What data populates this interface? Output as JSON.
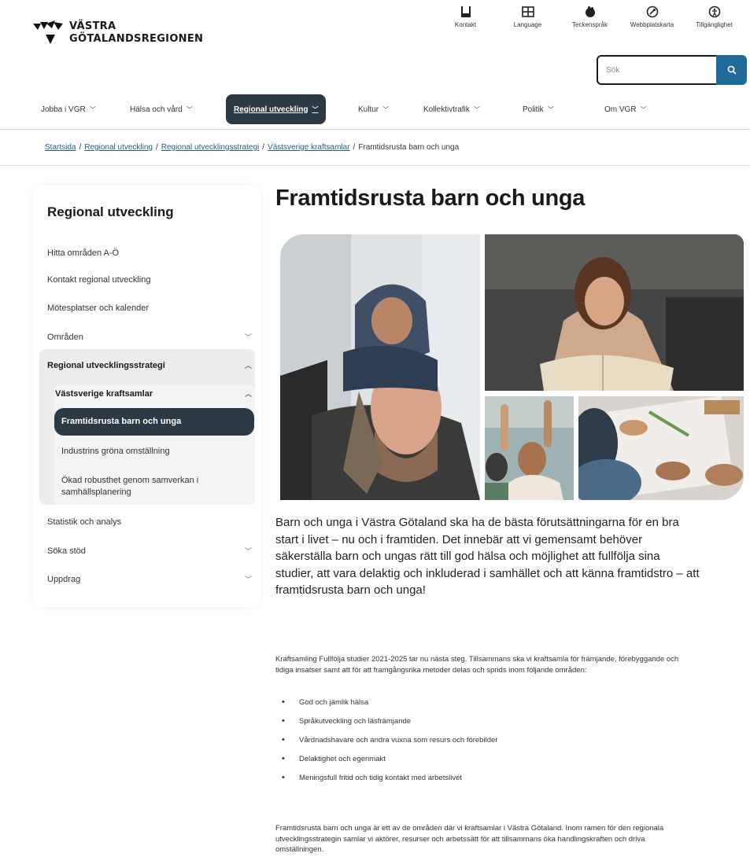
{
  "header": {
    "logo": {
      "line1": "VÄSTRA",
      "line2": "GÖTALANDSREGIONEN"
    },
    "util_nav": [
      {
        "label": "Kontakt",
        "icon": "phone-icon",
        "glyph": "☐"
      },
      {
        "label": "Language",
        "icon": "language-icon",
        "glyph": "⊞"
      },
      {
        "label": "Teckenspråk",
        "icon": "sign-language-icon",
        "glyph": "✋"
      },
      {
        "label": "Webbplatskarta",
        "icon": "sitemap-icon",
        "glyph": "⊘"
      },
      {
        "label": "Tillgänglighet",
        "icon": "accessibility-icon",
        "glyph": "☉"
      }
    ],
    "search": {
      "placeholder": "Sök"
    }
  },
  "main_nav": [
    {
      "label": "Jobba i VGR"
    },
    {
      "label": "Hälsa och vård"
    },
    {
      "label": "Regional utveckling"
    },
    {
      "label": "Kultur"
    },
    {
      "label": "Kollektivtrafik"
    },
    {
      "label": "Politik"
    },
    {
      "label": "Om VGR"
    }
  ],
  "breadcrumb": {
    "links": [
      "Startsida",
      "Regional utveckling",
      "Regional utvecklingsstrategi",
      "Västsverige kraftsamlar"
    ],
    "current": "Framtidsrusta barn och unga"
  },
  "sidebar": {
    "title": "Regional utveckling",
    "items": [
      {
        "label": "Hitta områden A-Ö"
      },
      {
        "label": "Kontakt regional utveckling"
      },
      {
        "label": "Mötesplatser och kalender"
      },
      {
        "label": "Områden"
      },
      {
        "label": "Regional utvecklingsstrategi"
      },
      {
        "label": "Västsverige kraftsamlar"
      },
      {
        "label": "Framtidsrusta barn och unga"
      },
      {
        "label": "Industrins gröna omställning"
      },
      {
        "label": "Ökad robusthet genom samverkan i samhällsplanering"
      },
      {
        "label": "Statistik och analys"
      },
      {
        "label": "Söka stöd"
      },
      {
        "label": "Uppdrag"
      }
    ]
  },
  "main": {
    "title": "Framtidsrusta barn och unga",
    "lead": "Barn och unga i Västra Götaland ska ha de bästa förutsättningarna för en bra start i livet – nu och i framtiden. Det innebär att vi gemensamt behöver säkerställa barn och ungas rätt till god hälsa och möjlighet att fullfölja sina studier, att vara delaktig och inkluderad i samhället och att känna framtidstro – att framtidsrusta barn och unga!",
    "intro": "Kraftsamling Fullfölja studier 2021-2025 tar nu nästa steg. Tillsammans ska vi kraftsamla för främjande, förebyggande och tidiga insatser samt att för att framgångsrika metoder delas och sprids inom följande områden:",
    "bullets": [
      "God och jämlik hälsa",
      "Språkutveckling och läsfrämjande",
      "Vårdnadshavare och andra vuxna som resurs och förebilder",
      "Delaktighet och egenmakt",
      "Meningsfull fritid och tidig kontakt med arbetslivet"
    ],
    "outro": "Framtidsrusta barn och unga är ett av de områden där vi kraftsamlar i Västra Götaland. Inom ramen för den regionala utvecklingsstrategin samlar vi aktörer, resurser och arbetssätt för att tillsammans öka handlingskraften och driva omställningen."
  },
  "colors": {
    "accent": "#1f6a98",
    "nav_active": "#2b3a44",
    "link": "#1f5f8a"
  }
}
